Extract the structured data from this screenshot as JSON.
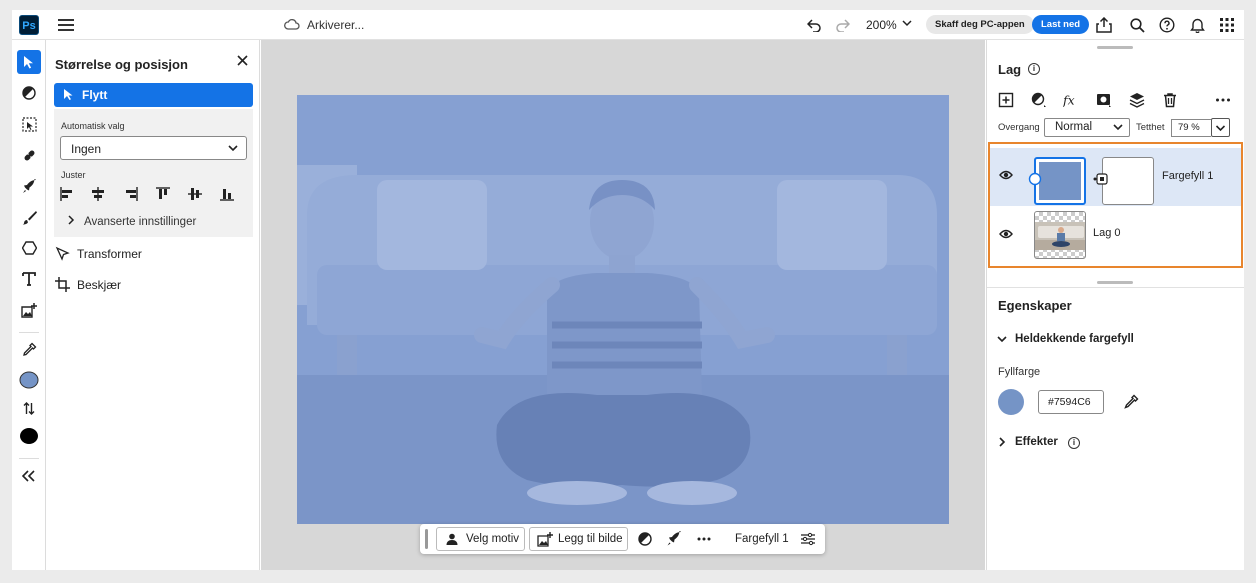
{
  "app": {
    "logo": "Ps",
    "status": "Arkiverer..."
  },
  "topbar": {
    "zoom": "200%",
    "get_app": "Skaff deg PC-appen",
    "download": "Last ned",
    "icons": [
      "undo-icon",
      "redo-icon",
      "share-icon",
      "search-icon",
      "help-icon",
      "bell-icon",
      "apps-grid-icon"
    ]
  },
  "toolbar": {
    "tools": [
      "move-tool-icon",
      "adjust-tool-icon",
      "select-subject-tool-icon",
      "heal-tool-icon",
      "quick-action-tool-icon",
      "brush-tool-icon",
      "shape-tool-icon",
      "type-tool-icon",
      "add-image-tool-icon",
      "eyedropper-tool-icon",
      "swap-colors-icon",
      "collapse-icon"
    ],
    "foreground_color": "#7594c6",
    "background_color": "#000000"
  },
  "panel": {
    "title": "Størrelse og posisjon",
    "active_tool": "Flytt",
    "auto_select_label": "Automatisk valg",
    "auto_select_value": "Ingen",
    "align_label": "Juster",
    "advanced": "Avanserte innstillinger",
    "transform": "Transformer",
    "crop": "Beskjær"
  },
  "contextbar": {
    "select_subject": "Velg motiv",
    "add_image": "Legg til bilde",
    "layer_name": "Fargefyll 1"
  },
  "layers": {
    "title": "Lag",
    "blend_label": "Overgang",
    "blend_value": "Normal",
    "opacity_label": "Tetthet",
    "opacity_value": "79 %",
    "items": [
      {
        "name": "Fargefyll 1",
        "selected": true
      },
      {
        "name": "Lag 0",
        "selected": false
      }
    ]
  },
  "properties": {
    "title": "Egenskaper",
    "section": "Heldekkende fargefyll",
    "fill_label": "Fyllfarge",
    "fill_hex": "#7594C6",
    "effects": "Effekter"
  },
  "colors": {
    "accent": "#1473e6",
    "fill": "#7594c6",
    "highlight": "#e8852d"
  }
}
